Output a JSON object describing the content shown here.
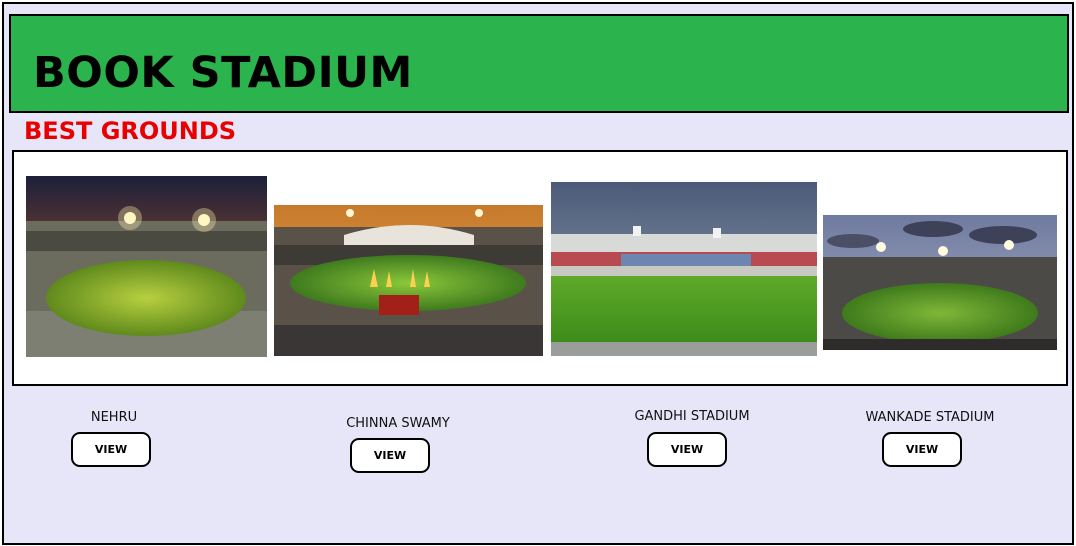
{
  "header": {
    "title": "BOOK STADIUM"
  },
  "section": {
    "title": "BEST GROUNDS"
  },
  "grounds": [
    {
      "name": "NEHRU",
      "button_label": "VIEW"
    },
    {
      "name": "CHINNA SWAMY",
      "button_label": "VIEW"
    },
    {
      "name": "GANDHI STADIUM",
      "button_label": "VIEW"
    },
    {
      "name": "WANKADE STADIUM",
      "button_label": "VIEW"
    }
  ],
  "colors": {
    "header_bg": "#2bb34e",
    "page_bg": "#e6e6f8",
    "section_title": "#e80000"
  }
}
